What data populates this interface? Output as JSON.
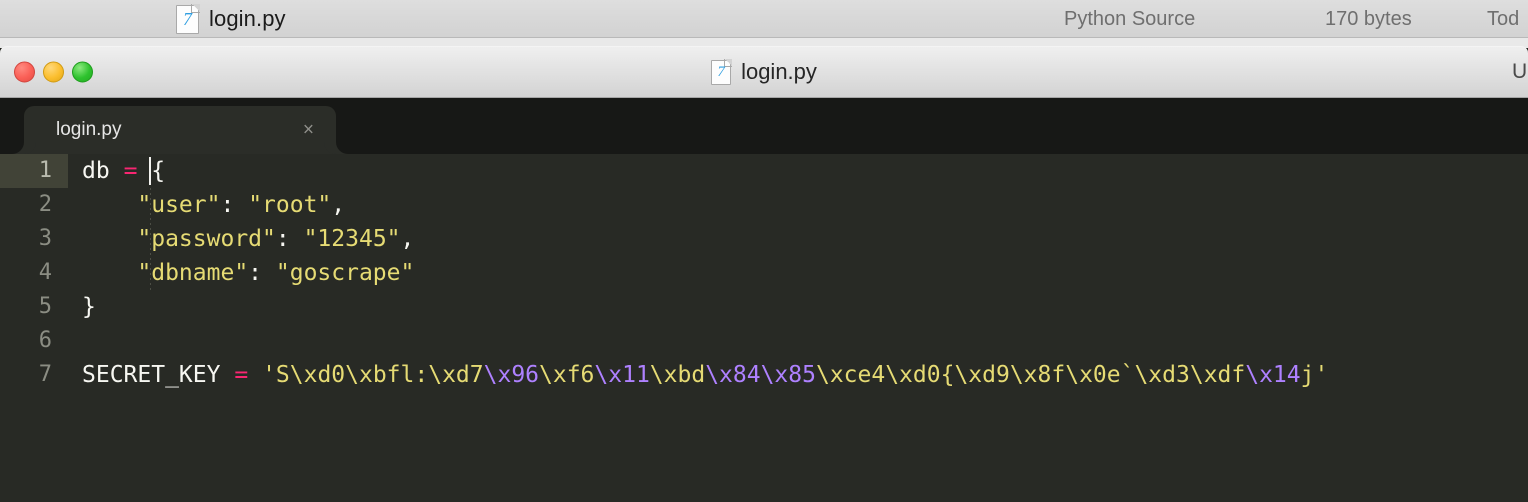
{
  "finder": {
    "file_icon": "python-file-icon",
    "filename": "login.py",
    "kind": "Python Source",
    "size": "170 bytes",
    "date": "Tod"
  },
  "window": {
    "title": "login.py",
    "title_icon": "python-file-icon",
    "right_label": "U",
    "traffic_lights": [
      {
        "name": "close-button",
        "color": "#fa5f56"
      },
      {
        "name": "minimize-button",
        "color": "#fbbe2e"
      },
      {
        "name": "zoom-button",
        "color": "#2ec22e"
      }
    ]
  },
  "editor": {
    "tab": {
      "label": "login.py",
      "close_glyph": "×"
    },
    "gutter": [
      "1",
      "2",
      "3",
      "4",
      "5",
      "6",
      "7"
    ],
    "lines": [
      {
        "number": "1",
        "active": true,
        "tokens": [
          {
            "t": "db",
            "c": "tok-plain"
          },
          {
            "t": " ",
            "c": "tok-plain"
          },
          {
            "t": "=",
            "c": "tok-op"
          },
          {
            "t": " ",
            "c": "tok-plain"
          },
          {
            "t": "{",
            "c": "tok-plain"
          }
        ]
      },
      {
        "number": "2",
        "active": false,
        "tokens": [
          {
            "t": "    ",
            "c": "tok-plain"
          },
          {
            "t": "\"user\"",
            "c": "tok-str"
          },
          {
            "t": ": ",
            "c": "tok-plain"
          },
          {
            "t": "\"root\"",
            "c": "tok-str"
          },
          {
            "t": ",",
            "c": "tok-plain"
          }
        ]
      },
      {
        "number": "3",
        "active": false,
        "tokens": [
          {
            "t": "    ",
            "c": "tok-plain"
          },
          {
            "t": "\"password\"",
            "c": "tok-str"
          },
          {
            "t": ": ",
            "c": "tok-plain"
          },
          {
            "t": "\"12345\"",
            "c": "tok-str"
          },
          {
            "t": ",",
            "c": "tok-plain"
          }
        ]
      },
      {
        "number": "4",
        "active": false,
        "tokens": [
          {
            "t": "    ",
            "c": "tok-plain"
          },
          {
            "t": "\"dbname\"",
            "c": "tok-str"
          },
          {
            "t": ": ",
            "c": "tok-plain"
          },
          {
            "t": "\"goscrape\"",
            "c": "tok-str"
          }
        ]
      },
      {
        "number": "5",
        "active": false,
        "tokens": [
          {
            "t": "}",
            "c": "tok-plain"
          }
        ]
      },
      {
        "number": "6",
        "active": false,
        "tokens": []
      },
      {
        "number": "7",
        "active": false,
        "tokens": [
          {
            "t": "SECRET_KEY",
            "c": "tok-plain"
          },
          {
            "t": " ",
            "c": "tok-plain"
          },
          {
            "t": "=",
            "c": "tok-op"
          },
          {
            "t": " ",
            "c": "tok-plain"
          },
          {
            "t": "'S\\xd0\\xbfl:\\xd7",
            "c": "tok-str"
          },
          {
            "t": "\\x96",
            "c": "tok-esc"
          },
          {
            "t": "\\xf6",
            "c": "tok-str"
          },
          {
            "t": "\\x11",
            "c": "tok-esc"
          },
          {
            "t": "\\xbd",
            "c": "tok-str"
          },
          {
            "t": "\\x84",
            "c": "tok-esc"
          },
          {
            "t": "\\x85",
            "c": "tok-esc"
          },
          {
            "t": "\\xce4\\xd0{\\xd9\\x8f\\x0e`\\xd3\\xdf",
            "c": "tok-str"
          },
          {
            "t": "\\x14",
            "c": "tok-esc"
          },
          {
            "t": "j'",
            "c": "tok-str"
          }
        ]
      }
    ],
    "full_source": "db = {\n    \"user\": \"root\",\n    \"password\": \"12345\",\n    \"dbname\": \"goscrape\"\n}\n\nSECRET_KEY = 'S\\xd0\\xbfl:\\xd7\\x96\\xf6\\x11\\xbd\\x84\\x85\\xce4\\xd0{\\xd9\\x8f\\x0e`\\xd3\\xdf\\x14j'",
    "colors": {
      "background": "#282a25",
      "tabbar": "#171816",
      "active_tab": "#2b2d28",
      "active_line_gutter": "#414337",
      "text": "#f7f7f2",
      "string": "#e6db74",
      "operator": "#f92672",
      "escape": "#ae81ff",
      "line_number": "#8b8d83"
    }
  }
}
